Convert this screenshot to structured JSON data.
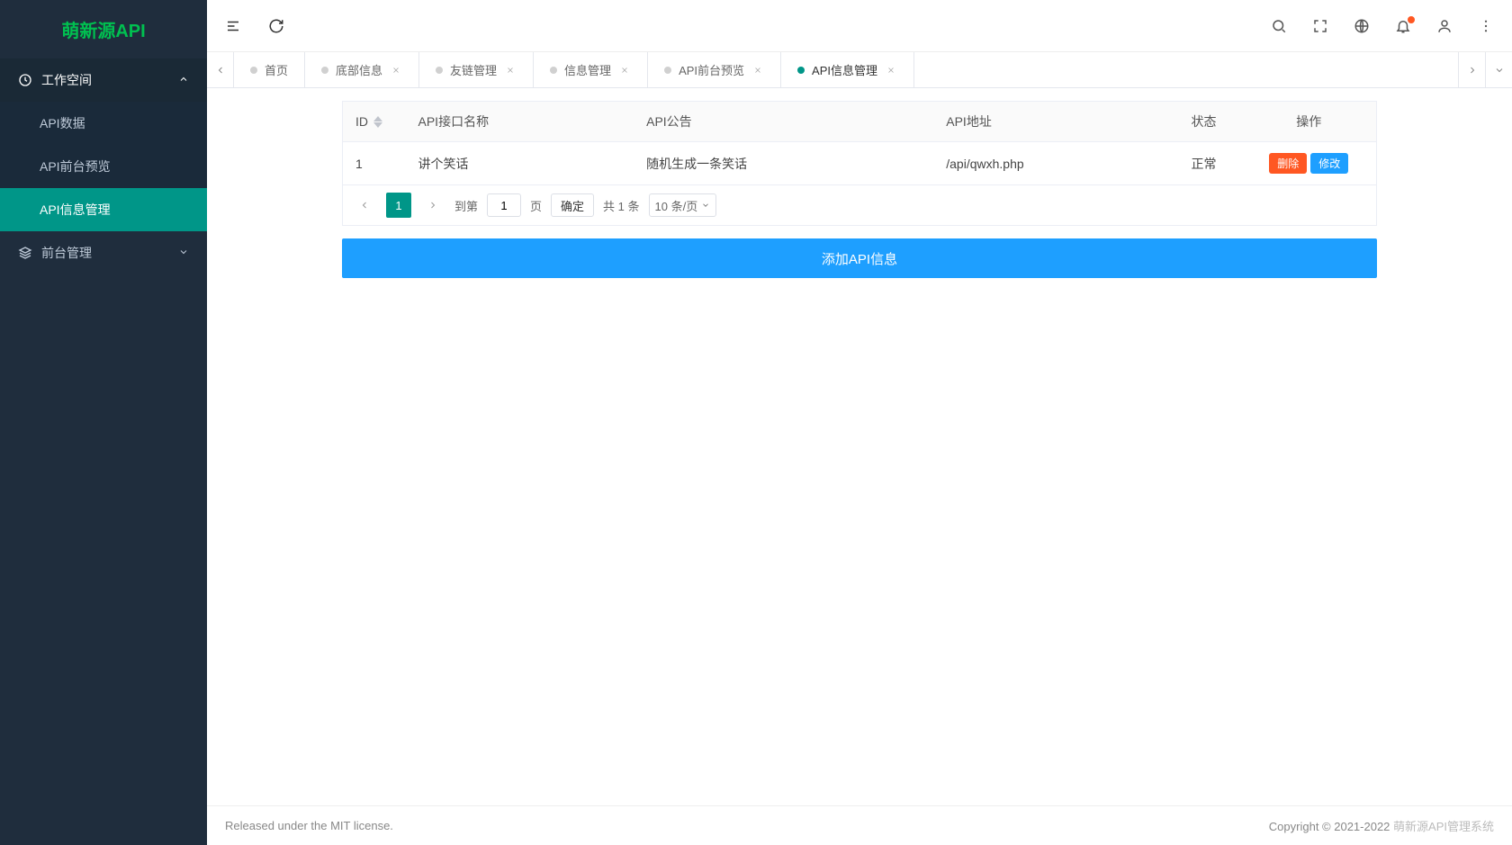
{
  "app_title": "萌新源API",
  "sidebar": {
    "workspace": {
      "label": "工作空间"
    },
    "items": [
      {
        "label": "API数据"
      },
      {
        "label": "API前台预览"
      },
      {
        "label": "API信息管理"
      }
    ],
    "frontend": {
      "label": "前台管理"
    }
  },
  "tabs": [
    {
      "label": "首页",
      "closable": false
    },
    {
      "label": "底部信息",
      "closable": true
    },
    {
      "label": "友链管理",
      "closable": true
    },
    {
      "label": "信息管理",
      "closable": true
    },
    {
      "label": "API前台预览",
      "closable": true
    },
    {
      "label": "API信息管理",
      "closable": true,
      "active": true
    }
  ],
  "table": {
    "headers": {
      "id": "ID",
      "name": "API接口名称",
      "notice": "API公告",
      "url": "API地址",
      "status": "状态",
      "action": "操作"
    },
    "rows": [
      {
        "id": "1",
        "name": "讲个笑话",
        "notice": "随机生成一条笑话",
        "url": "/api/qwxh.php",
        "status": "正常"
      }
    ],
    "actions": {
      "delete": "删除",
      "edit": "修改"
    }
  },
  "pagination": {
    "goto_label": "到第",
    "page_value": "1",
    "page_unit": "页",
    "confirm": "确定",
    "total_text": "共 1 条",
    "per_page": "10 条/页",
    "current": "1"
  },
  "add_button": "添加API信息",
  "footer": {
    "left": "Released under the MIT license.",
    "right": "Copyright © 2021-2022 ",
    "right_muted": "萌新源API管理系统"
  }
}
